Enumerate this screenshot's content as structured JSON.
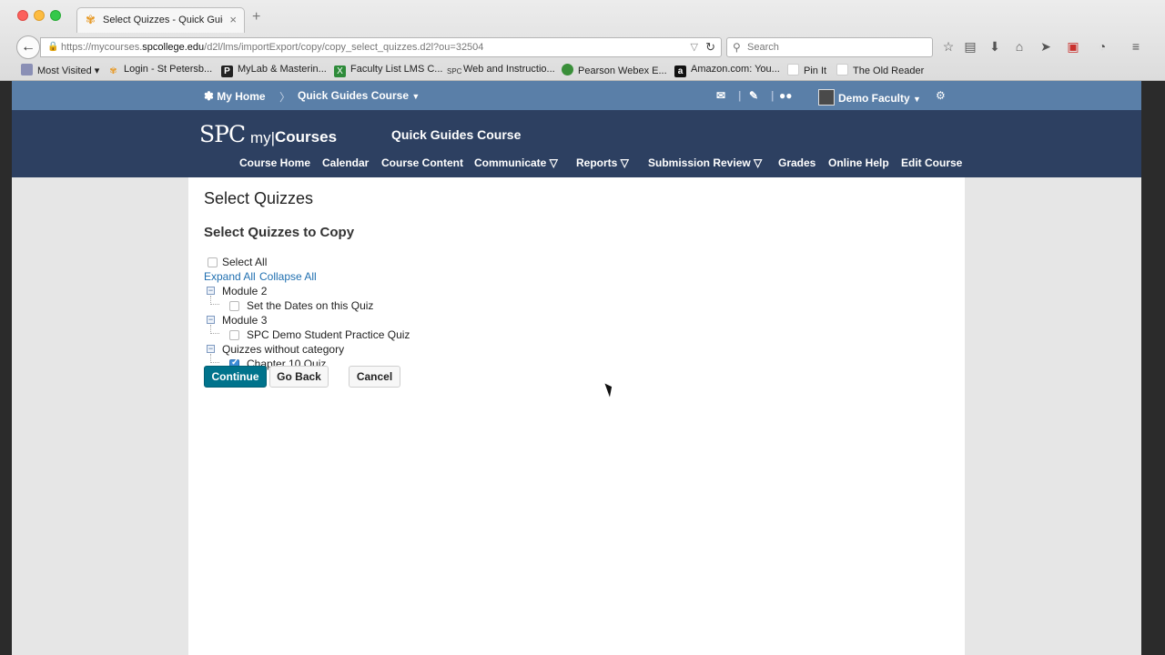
{
  "browser": {
    "tab_title": "Select Quizzes - Quick Guid...",
    "url_prefix": "https://mycourses.",
    "url_domain": "spcollege.edu",
    "url_path": "/d2l/lms/importExport/copy/copy_select_quizzes.d2l?ou=32504",
    "search_placeholder": "Search",
    "bookmarks": [
      {
        "label": "Most Visited",
        "icon": "folder-icon"
      },
      {
        "label": "Login - St Petersb...",
        "icon": "spc-star-icon"
      },
      {
        "label": "MyLab & Masterin...",
        "icon": "p-icon"
      },
      {
        "label": "Faculty List LMS C...",
        "icon": "excel-icon"
      },
      {
        "label": "Web and Instructio...",
        "icon": "spc-icon"
      },
      {
        "label": "Pearson Webex E...",
        "icon": "globe-icon"
      },
      {
        "label": "Amazon.com: You...",
        "icon": "amazon-icon"
      },
      {
        "label": "Pin It",
        "icon": "page-icon"
      },
      {
        "label": "The Old Reader",
        "icon": "page-icon"
      }
    ]
  },
  "topbar": {
    "my_home": "My Home",
    "course_menu": "Quick Guides Course",
    "user": "Demo Faculty"
  },
  "header": {
    "logo_spc": "SPC",
    "logo_my": "my|",
    "logo_courses": "Courses",
    "course_title": "Quick Guides Course",
    "nav": [
      {
        "label": "Course Home"
      },
      {
        "label": "Calendar"
      },
      {
        "label": "Course Content"
      },
      {
        "label": "Communicate ▽"
      },
      {
        "label": "Reports ▽"
      },
      {
        "label": "Submission Review ▽"
      },
      {
        "label": "Grades"
      },
      {
        "label": "Online Help"
      },
      {
        "label": "Edit Course"
      }
    ]
  },
  "main": {
    "page_title": "Select Quizzes",
    "section_title": "Select Quizzes to Copy",
    "select_all": "Select All",
    "expand_all": "Expand All",
    "collapse_all": "Collapse All",
    "tree": [
      {
        "category": "Module 2",
        "items": [
          {
            "label": "Set the Dates on this Quiz",
            "checked": false
          }
        ]
      },
      {
        "category": "Module 3",
        "items": [
          {
            "label": "SPC Demo Student Practice Quiz",
            "checked": false
          }
        ]
      },
      {
        "category": "Quizzes without category",
        "items": [
          {
            "label": "Chapter 10 Quiz",
            "checked": true
          }
        ]
      }
    ],
    "continue_label": "Continue",
    "go_back_label": "Go Back",
    "cancel_label": "Cancel"
  }
}
